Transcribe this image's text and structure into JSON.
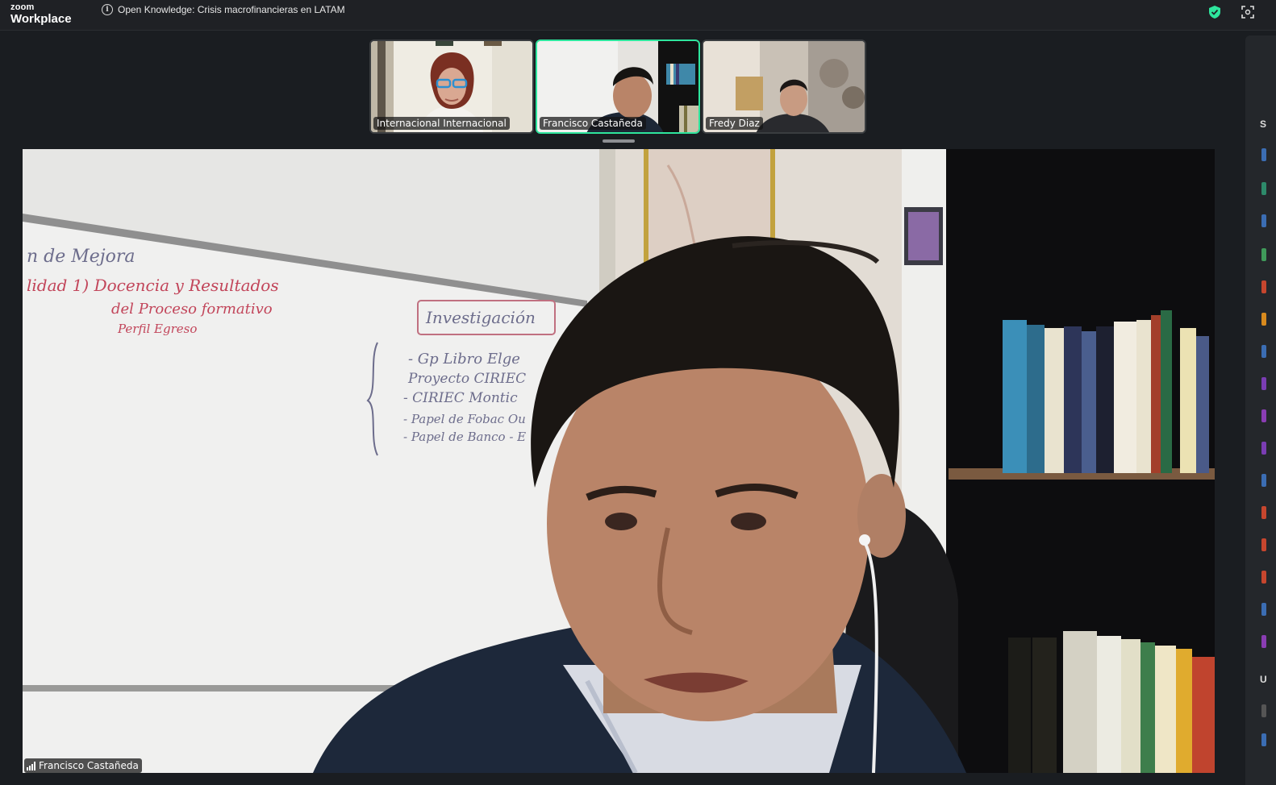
{
  "app": {
    "brand_small": "zoom",
    "brand_large": "Workplace"
  },
  "meeting": {
    "title": "Open Knowledge: Crisis macrofinancieras en LATAM"
  },
  "icons": {
    "info": "info-icon",
    "security": "shield-icon",
    "fullscreen": "fullscreen-icon",
    "signal": "signal-icon"
  },
  "colors": {
    "active_speaker_border": "#2ee59d",
    "shield": "#2ee59d",
    "titlebar_bg": "#1f2125"
  },
  "participants": [
    {
      "name": "Internacional Internacional",
      "active": false
    },
    {
      "name": "Francisco Castañeda",
      "active": true
    },
    {
      "name": "Fredy Diaz",
      "active": false
    }
  ],
  "main_video": {
    "speaker_name": "Francisco Castañeda"
  },
  "whiteboard_text": {
    "line1": "n de Mejora",
    "line2": "lidad 1) Docencia y Resultados",
    "line3": "del Proceso formativo",
    "line4": "Perfil Egreso",
    "box": "Investigación",
    "list1": "- Gp Libro Elge",
    "list2": "Proyecto CIRIEC",
    "list3": "- CIRIEC Montic",
    "list4": "- Papel de Fobac Ou",
    "list5": "- Papel de Banco - E"
  },
  "right_panel": {
    "label_top": "S",
    "label_bottom": "U"
  }
}
